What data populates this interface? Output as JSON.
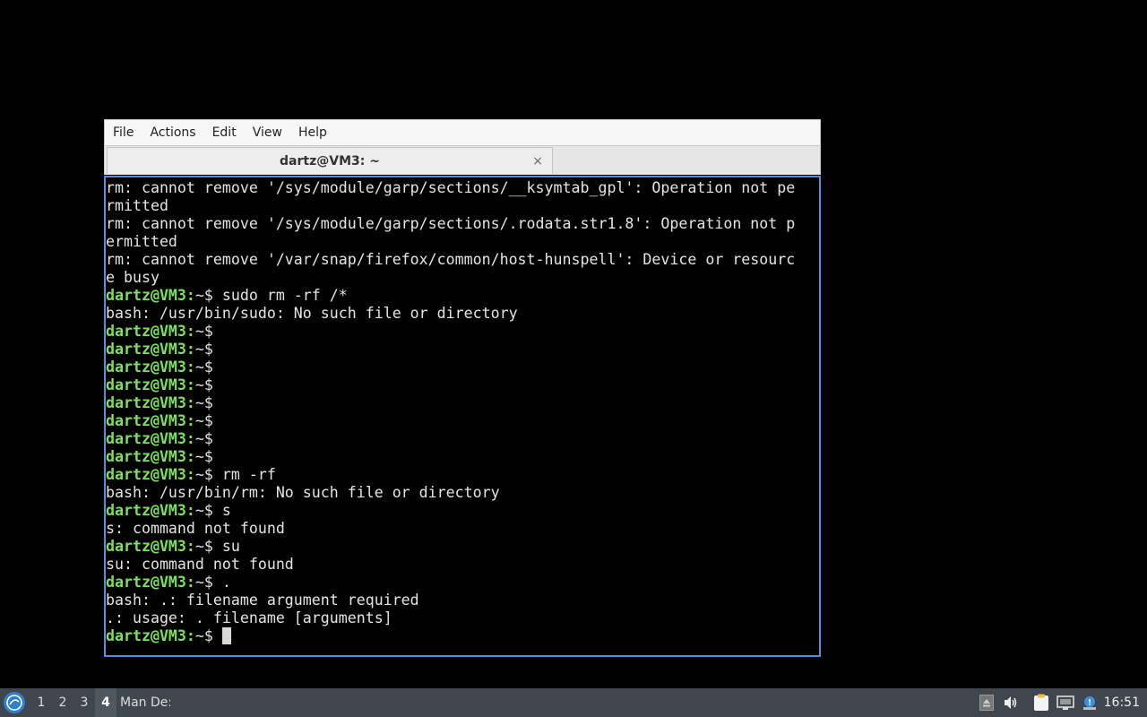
{
  "menu": [
    "File",
    "Actions",
    "Edit",
    "View",
    "Help"
  ],
  "tab": {
    "title": "dartz@VM3: ~",
    "close": "×"
  },
  "prompt": "dartz@VM3:",
  "prompt_suffix": "~$",
  "terminal_lines": [
    {
      "prompt": false,
      "text": "rm: cannot remove '/sys/module/garp/sections/__ksymtab_gpl': Operation not pe"
    },
    {
      "prompt": false,
      "text": "rmitted"
    },
    {
      "prompt": false,
      "text": "rm: cannot remove '/sys/module/garp/sections/.rodata.str1.8': Operation not p"
    },
    {
      "prompt": false,
      "text": "ermitted"
    },
    {
      "prompt": false,
      "text": "rm: cannot remove '/var/snap/firefox/common/host-hunspell': Device or resourc"
    },
    {
      "prompt": false,
      "text": "e busy"
    },
    {
      "prompt": true,
      "text": " sudo rm -rf /*"
    },
    {
      "prompt": false,
      "text": "bash: /usr/bin/sudo: No such file or directory"
    },
    {
      "prompt": true,
      "text": ""
    },
    {
      "prompt": true,
      "text": ""
    },
    {
      "prompt": true,
      "text": ""
    },
    {
      "prompt": true,
      "text": ""
    },
    {
      "prompt": true,
      "text": ""
    },
    {
      "prompt": true,
      "text": ""
    },
    {
      "prompt": true,
      "text": ""
    },
    {
      "prompt": true,
      "text": ""
    },
    {
      "prompt": true,
      "text": " rm -rf"
    },
    {
      "prompt": false,
      "text": "bash: /usr/bin/rm: No such file or directory"
    },
    {
      "prompt": true,
      "text": " s"
    },
    {
      "prompt": false,
      "text": "s: command not found"
    },
    {
      "prompt": true,
      "text": " su"
    },
    {
      "prompt": false,
      "text": "su: command not found"
    },
    {
      "prompt": true,
      "text": " ."
    },
    {
      "prompt": false,
      "text": "bash: .: filename argument required"
    },
    {
      "prompt": false,
      "text": ".: usage: . filename [arguments]"
    },
    {
      "prompt": true,
      "text": " ",
      "cursor": true
    }
  ],
  "taskbar": {
    "desktops": [
      "1",
      "2",
      "3",
      "4"
    ],
    "active_desktop": "4",
    "tasks": [
      "Mani",
      "De:"
    ],
    "clock": "16:51"
  },
  "colors": {
    "prompt": "#7be25a",
    "terminal_border": "#5b8ed9",
    "taskbar": "#3f464d"
  }
}
